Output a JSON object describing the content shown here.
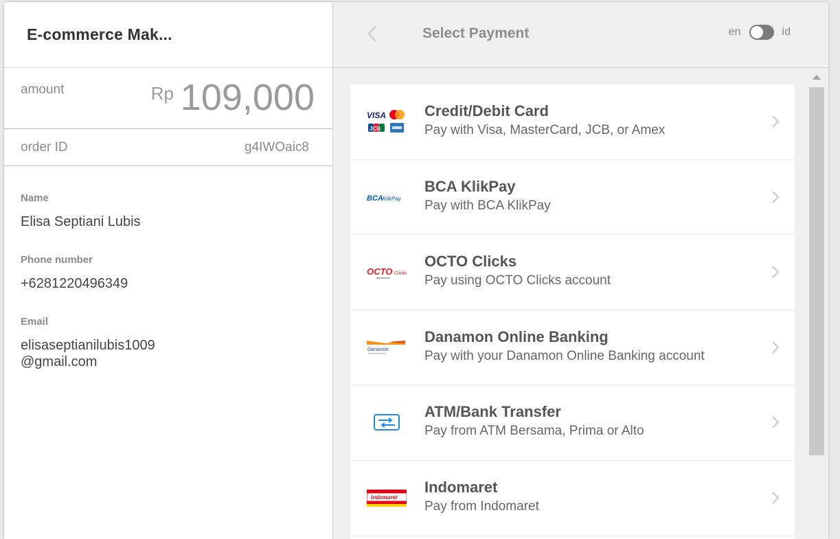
{
  "merchant": {
    "name": "E-commerce Mak..."
  },
  "order": {
    "amount_label": "amount",
    "currency": "Rp",
    "amount": "109,000",
    "order_id_label": "order ID",
    "order_id": "g4IWOaic8"
  },
  "customer": {
    "name_label": "Name",
    "name": "Elisa Septiani Lubis",
    "phone_label": "Phone number",
    "phone": "+6281220496349",
    "email_label": "Email",
    "email": "elisaseptianilubis1009@gmail.com"
  },
  "header": {
    "title": "Select Payment",
    "lang_en": "en",
    "lang_id": "id",
    "lang_toggle_state": "en"
  },
  "payment_methods": [
    {
      "title": "Credit/Debit Card",
      "desc": "Pay with Visa, MasterCard, JCB, or Amex",
      "icon": "card-brands-logo"
    },
    {
      "title": "BCA KlikPay",
      "desc": "Pay with BCA KlikPay",
      "icon": "bca-klikpay-logo",
      "logo_text": "BCA KlikPay"
    },
    {
      "title": "OCTO Clicks",
      "desc": "Pay using OCTO Clicks account",
      "icon": "octo-clicks-logo",
      "logo_text": "OCTO Clicks"
    },
    {
      "title": "Danamon Online Banking",
      "desc": "Pay with your Danamon Online Banking account",
      "icon": "danamon-logo",
      "logo_text": "Danamon"
    },
    {
      "title": "ATM/Bank Transfer",
      "desc": "Pay from ATM Bersama, Prima or Alto",
      "icon": "bank-transfer-icon"
    },
    {
      "title": "Indomaret",
      "desc": "Pay from Indomaret",
      "icon": "indomaret-logo",
      "logo_text": "Indomaret"
    }
  ],
  "colors": {
    "visa_blue": "#1a1f71",
    "mastercard_red": "#eb001b",
    "mastercard_orange": "#f79e1b",
    "bca_blue": "#0060af",
    "octo_red": "#e31e24",
    "danamon_orange": "#f7941d",
    "transfer_blue": "#1e88e5",
    "indomaret_red": "#e30613",
    "indomaret_yellow": "#ffd400"
  }
}
